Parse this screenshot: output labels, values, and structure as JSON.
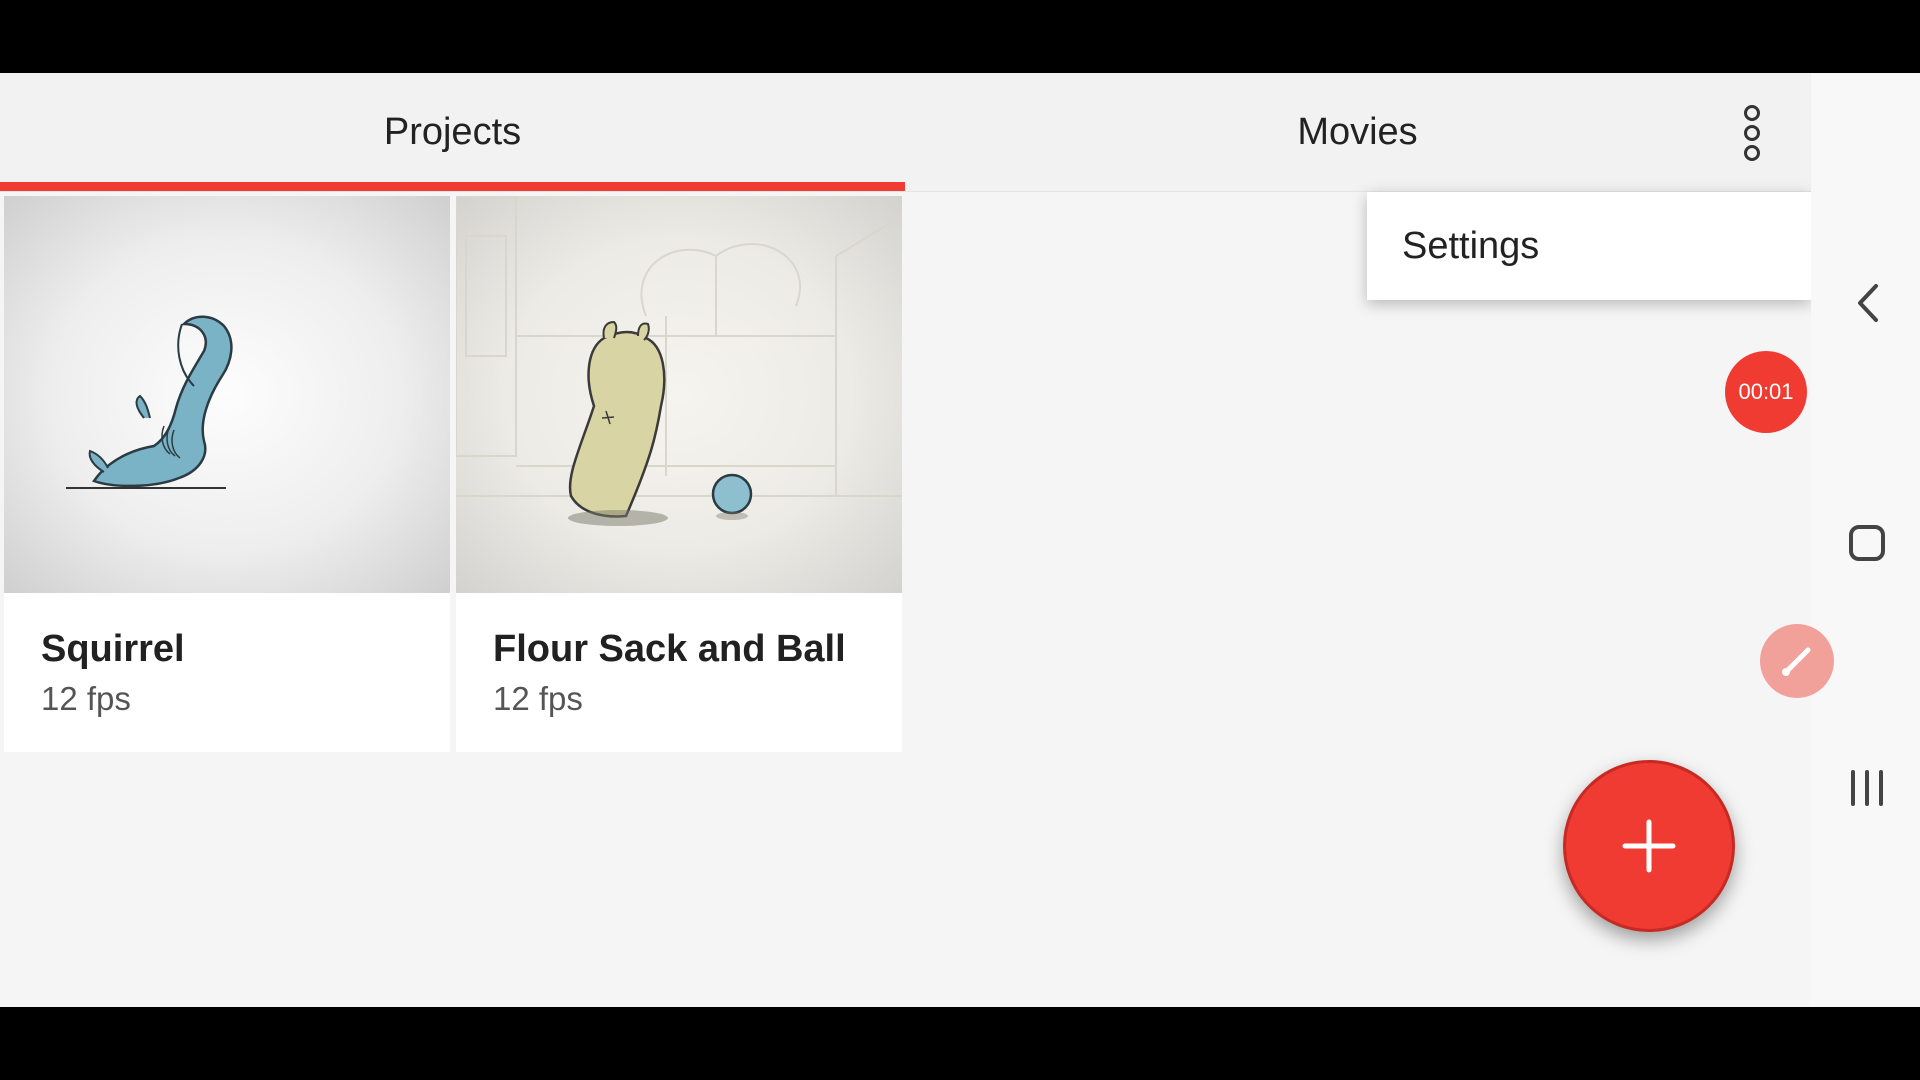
{
  "tabs": [
    {
      "label": "Projects",
      "selected": true
    },
    {
      "label": "Movies",
      "selected": false
    }
  ],
  "overflow_menu": {
    "icon": "more-vert-icon",
    "items": [
      {
        "label": "Settings"
      }
    ]
  },
  "projects": [
    {
      "title": "Squirrel",
      "subtitle": "12 fps",
      "thumbnail": "squirrel-drawing"
    },
    {
      "title": "Flour Sack and Ball",
      "subtitle": "12 fps",
      "thumbnail": "flour-sack-drawing"
    }
  ],
  "recording": {
    "timer": "00:01"
  },
  "fab": {
    "icon": "plus-icon"
  },
  "colors": {
    "accent": "#f03b32",
    "background": "#f5f5f5"
  },
  "nav": {
    "back": "chevron-left-icon",
    "home": "home-icon",
    "recents": "recents-icon"
  }
}
